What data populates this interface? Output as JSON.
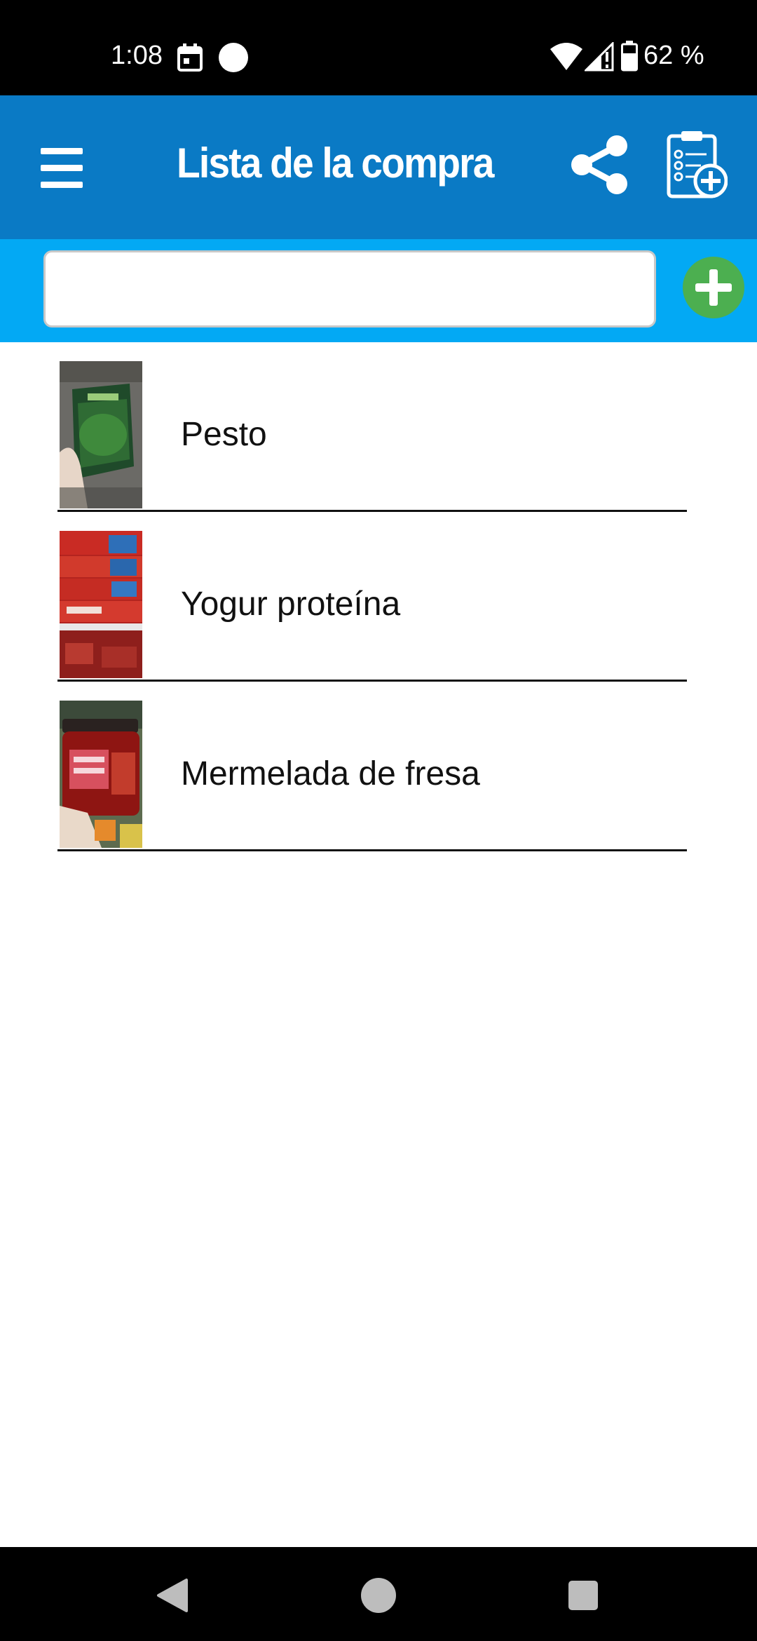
{
  "status_bar": {
    "time": "1:08",
    "battery": "62 %",
    "icons": [
      "calendar-icon",
      "circle-notification-icon",
      "wifi-icon",
      "signal-icon",
      "battery-icon"
    ]
  },
  "header": {
    "title": "Lista de la compra",
    "icons": [
      "hamburger-menu-icon",
      "share-icon",
      "clipboard-add-icon"
    ],
    "background": "#0a7ac5"
  },
  "input_bar": {
    "value": "",
    "placeholder": "",
    "background": "#03a9f4",
    "add_button_color": "#4caf50"
  },
  "items": [
    {
      "label": "Pesto",
      "thumbnail": "pesto-package-photo"
    },
    {
      "label": "Yogur proteína",
      "thumbnail": "yogurt-shelf-photo"
    },
    {
      "label": "Mermelada de fresa",
      "thumbnail": "strawberry-jam-jar-photo"
    }
  ],
  "nav_bar": {
    "icons": [
      "back-icon",
      "home-icon",
      "recents-icon"
    ]
  }
}
